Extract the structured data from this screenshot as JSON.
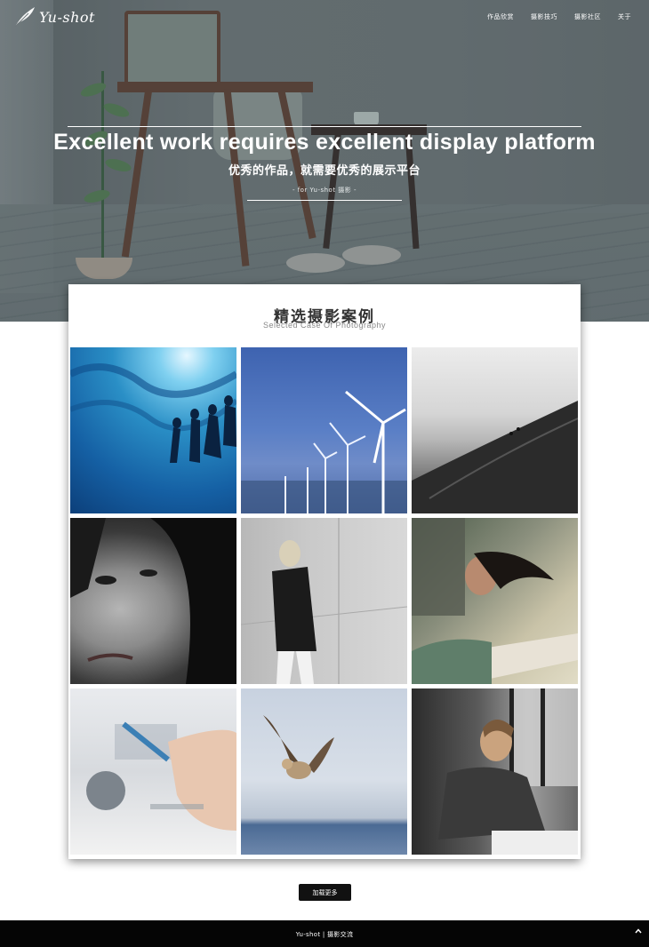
{
  "brand": {
    "name": "Yu-shot"
  },
  "nav": {
    "items": [
      {
        "label": "作品欣赏"
      },
      {
        "label": "摄影技巧"
      },
      {
        "label": "摄影社区"
      },
      {
        "label": "关于"
      }
    ]
  },
  "hero": {
    "title": "Excellent work requires excellent display platform",
    "subtitle": "优秀的作品，就需要优秀的展示平台",
    "tagline": "- for Yu-shot 摄影 -"
  },
  "gallery": {
    "title": "精选摄影案例",
    "subtitle": "Selected Case Of Photography",
    "photos": [
      {
        "subject": "underwater swimmers"
      },
      {
        "subject": "wind turbines"
      },
      {
        "subject": "sand dune climbers"
      },
      {
        "subject": "woman face portrait"
      },
      {
        "subject": "woman leaning on wall"
      },
      {
        "subject": "woman with windblown hair"
      },
      {
        "subject": "hand holding tablet"
      },
      {
        "subject": "owl in flight"
      },
      {
        "subject": "man writing at desk"
      }
    ]
  },
  "actions": {
    "load_more": "加载更多"
  },
  "footer": {
    "text": "Yu-shot | 摄影交流",
    "back_to_top_icon": "chevron-up-icon"
  },
  "colors": {
    "footer_bg": "#050505",
    "button_bg": "#111111",
    "hero_tint": "#5f686b"
  }
}
